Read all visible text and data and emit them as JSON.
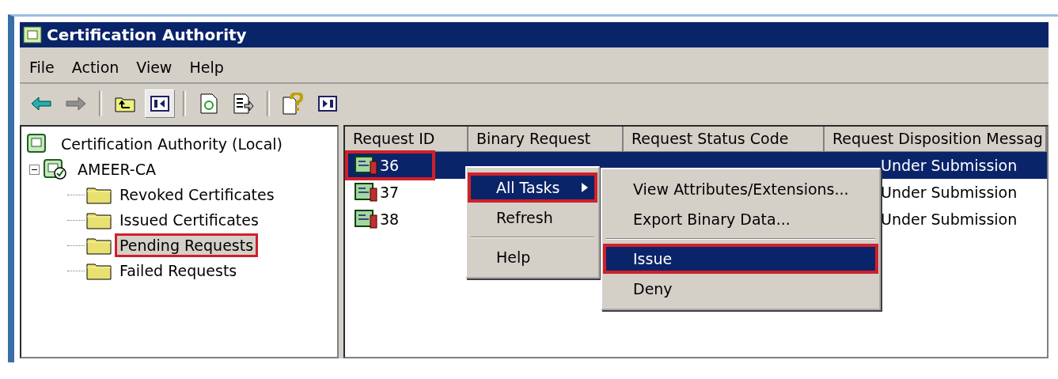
{
  "window": {
    "title": "Certification Authority"
  },
  "menu_bar": [
    "File",
    "Action",
    "View",
    "Help"
  ],
  "toolbar": [
    {
      "kind": "back",
      "pressed": false
    },
    {
      "kind": "forward",
      "pressed": false
    },
    {
      "kind": "separator"
    },
    {
      "kind": "up",
      "pressed": false
    },
    {
      "kind": "tree",
      "pressed": true
    },
    {
      "kind": "separator"
    },
    {
      "kind": "refresh",
      "pressed": false
    },
    {
      "kind": "export",
      "pressed": false
    },
    {
      "kind": "separator"
    },
    {
      "kind": "help",
      "pressed": false
    },
    {
      "kind": "pane",
      "pressed": false
    }
  ],
  "tree": {
    "label": "Certification Authority (Local)",
    "children": [
      {
        "label": "AMEER-CA",
        "expanded": true,
        "children": [
          {
            "label": "Revoked Certificates",
            "selected": false,
            "highlighted": false
          },
          {
            "label": "Issued Certificates",
            "selected": false,
            "highlighted": false
          },
          {
            "label": "Pending Requests",
            "selected": true,
            "highlighted": true
          },
          {
            "label": "Failed Requests",
            "selected": false,
            "highlighted": false
          }
        ]
      }
    ]
  },
  "list": {
    "columns": [
      "Request ID",
      "Binary Request",
      "Request Status Code",
      "Request Disposition Messag"
    ],
    "rows": [
      {
        "request_id": "36",
        "disposition_message": "Under Submission",
        "selected": true,
        "highlighted": true
      },
      {
        "request_id": "37",
        "disposition_message": "Under Submission",
        "selected": false,
        "highlighted": false
      },
      {
        "request_id": "38",
        "disposition_message": "Under Submission",
        "selected": false,
        "highlighted": false
      }
    ]
  },
  "context_menu": {
    "items": [
      {
        "kind": "item",
        "label": "All Tasks",
        "submenu": true,
        "selected": true,
        "highlighted": true
      },
      {
        "kind": "item",
        "label": "Refresh",
        "submenu": false,
        "selected": false,
        "highlighted": false
      },
      {
        "kind": "separator"
      },
      {
        "kind": "item",
        "label": "Help",
        "submenu": false,
        "selected": false,
        "highlighted": false
      }
    ]
  },
  "submenu": {
    "items": [
      {
        "kind": "item",
        "label": "View Attributes/Extensions...",
        "selected": false,
        "highlighted": false
      },
      {
        "kind": "item",
        "label": "Export Binary Data...",
        "selected": false,
        "highlighted": false
      },
      {
        "kind": "separator"
      },
      {
        "kind": "item",
        "label": "Issue",
        "selected": true,
        "highlighted": true
      },
      {
        "kind": "item",
        "label": "Deny",
        "selected": false,
        "highlighted": false
      }
    ]
  }
}
